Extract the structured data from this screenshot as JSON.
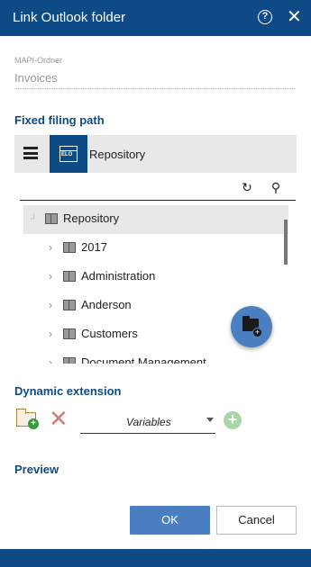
{
  "dialog": {
    "title": "Link Outlook folder",
    "help_icon": "?",
    "close_icon": "✕"
  },
  "mapi": {
    "label": "MAPI-Ordner",
    "value": "Invoices"
  },
  "fixed_path": {
    "heading": "Fixed filing path",
    "current": "Repository"
  },
  "tree": {
    "root": "Repository",
    "items": [
      {
        "label": "2017",
        "icon": "cabinet-icon"
      },
      {
        "label": "Administration",
        "icon": "cabinet-icon"
      },
      {
        "label": "Anderson",
        "icon": "cabinet-link-icon"
      },
      {
        "label": "Customers",
        "icon": "cabinet-icon"
      },
      {
        "label": "Document Management",
        "icon": "cabinet-icon"
      }
    ]
  },
  "dynamic": {
    "heading": "Dynamic extension",
    "variables_value": "Variables"
  },
  "preview": {
    "heading": "Preview"
  },
  "buttons": {
    "ok": "OK",
    "cancel": "Cancel"
  },
  "colors": {
    "brand": "#0d4a86",
    "primary_button": "#4a7fc1"
  }
}
